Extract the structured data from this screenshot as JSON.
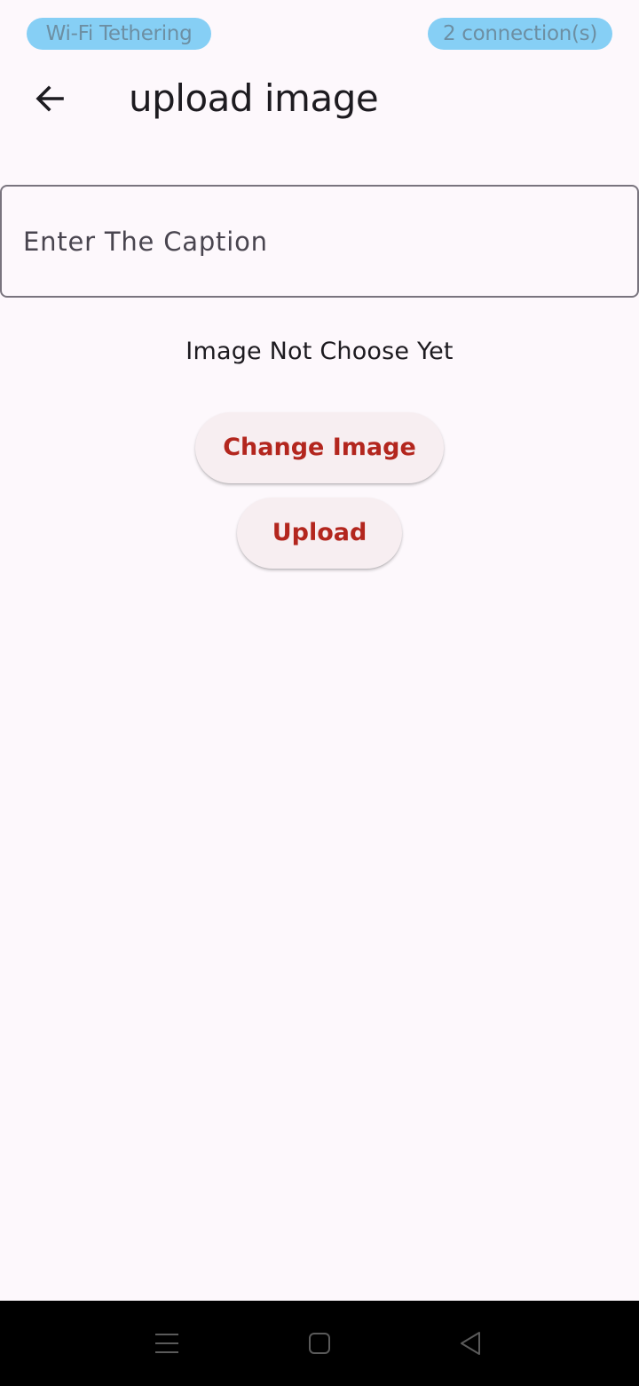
{
  "status_bar": {
    "left_pill": "Wi-Fi Tethering",
    "right_pill": "2 connection(s)",
    "pill_color": "#86cff5"
  },
  "app_bar": {
    "back_icon": "arrow-left-icon",
    "title": "upload image"
  },
  "caption_input": {
    "placeholder": "Enter The Caption",
    "value": ""
  },
  "image_status": "Image Not Choose Yet",
  "buttons": {
    "change_image": "Change Image",
    "upload": "Upload"
  },
  "colors": {
    "accent": "#b3261e",
    "button_bg": "#f7eef1",
    "background": "#fdf8fc"
  },
  "nav_bar": {
    "icons": [
      "menu-icon",
      "home-square-icon",
      "back-triangle-icon"
    ]
  }
}
